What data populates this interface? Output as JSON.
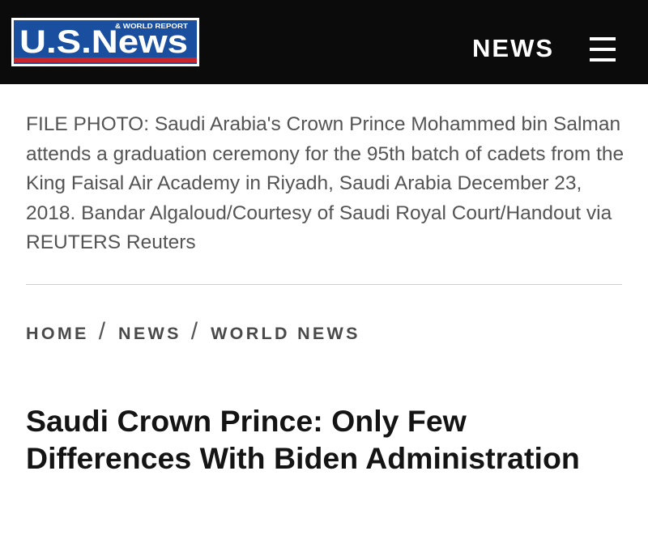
{
  "header": {
    "logo": {
      "main_text": "U.S.News",
      "sub_text": "& WORLD REPORT",
      "colors": {
        "blue": "#1a4fa0",
        "red": "#c8272d",
        "white": "#ffffff"
      }
    },
    "nav_label": "NEWS",
    "menu_icon": "hamburger-menu-icon",
    "background": "#0b0b0b"
  },
  "photo_caption": "FILE PHOTO: Saudi Arabia's Crown Prince Mohammed bin Salman attends a graduation ceremony for the 95th batch of cadets from the King Faisal Air Academy in Riyadh, Saudi Arabia December 23, 2018. Bandar Algaloud/Courtesy of Saudi Royal Court/Handout via REUTERS Reuters",
  "breadcrumb": {
    "items": [
      {
        "label": "HOME"
      },
      {
        "label": "NEWS"
      },
      {
        "label": "WORLD NEWS"
      }
    ],
    "separator": "/"
  },
  "article": {
    "headline": "Saudi Crown Prince: Only Few Differences With Biden Administration"
  }
}
